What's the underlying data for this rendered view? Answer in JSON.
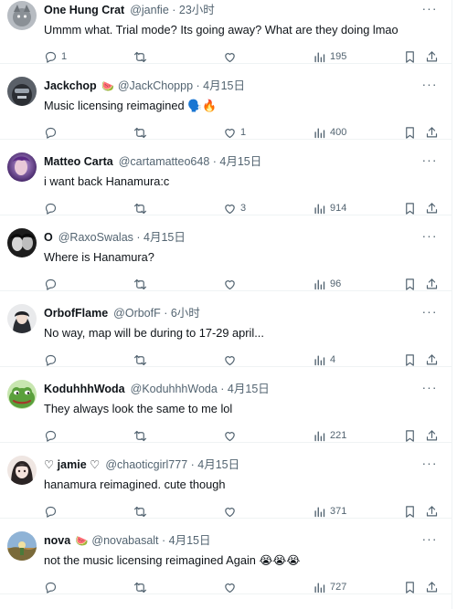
{
  "replies": [
    {
      "name": "One Hung Crat",
      "badge": "",
      "handle": "@janfie",
      "sep": " · ",
      "time": "23小时",
      "text": "Ummm what. Trial mode? Its going away? What are they doing lmao",
      "reply_count": "1",
      "retweet_count": "",
      "like_count": "",
      "views": "195",
      "avatar_color": "#9aa0a6"
    },
    {
      "name": "Jackchop",
      "badge": "🍉",
      "handle": "@JackChoppp",
      "sep": " · ",
      "time": "4月15日",
      "text": "Music licensing reimagined 🗣️🔥",
      "reply_count": "",
      "retweet_count": "",
      "like_count": "1",
      "views": "400",
      "avatar_color": "#3c4048"
    },
    {
      "name": "Matteo Carta",
      "badge": "",
      "handle": "@cartamatteo648",
      "sep": " · ",
      "time": "4月15日",
      "text": "i want back Hanamura:c",
      "reply_count": "",
      "retweet_count": "",
      "like_count": "3",
      "views": "914",
      "avatar_color": "#6b3fa0"
    },
    {
      "name": "O",
      "badge": "",
      "handle": "@RaxoSwalas",
      "sep": " · ",
      "time": "4月15日",
      "text": "Where is Hanamura?",
      "reply_count": "",
      "retweet_count": "",
      "like_count": "",
      "views": "96",
      "avatar_color": "#2a2a2a"
    },
    {
      "name": "OrbofFlame",
      "badge": "",
      "handle": "@OrbofF",
      "sep": " · ",
      "time": "6小时",
      "text": "No way, map will be during to 17-29 april...",
      "reply_count": "",
      "retweet_count": "",
      "like_count": "",
      "views": "4",
      "avatar_color": "#4a4f58"
    },
    {
      "name": "KoduhhhWoda",
      "badge": "",
      "handle": "@KoduhhhWoda",
      "sep": " · ",
      "time": "4月15日",
      "text": "They always look the same to me lol",
      "reply_count": "",
      "retweet_count": "",
      "like_count": "",
      "views": "221",
      "avatar_color": "#4f8f3a"
    },
    {
      "name": "♡ jamie ♡",
      "badge": "",
      "handle": "@chaoticgirl777",
      "sep": " · ",
      "time": "4月15日",
      "text": "hanamura reimagined. cute though",
      "reply_count": "",
      "retweet_count": "",
      "like_count": "",
      "views": "371",
      "avatar_color": "#d9c7c2"
    },
    {
      "name": "nova",
      "badge": "🍉",
      "handle": "@novabasalt",
      "sep": " · ",
      "time": "4月15日",
      "text": "not the music licensing reimagined Again 😭😭😭",
      "reply_count": "",
      "retweet_count": "",
      "like_count": "",
      "views": "727",
      "avatar_color": "#c9a35a"
    }
  ],
  "more_label": "···",
  "colors": {
    "text": "#0f1419",
    "muted": "#536471",
    "divider": "#eff3f4"
  }
}
